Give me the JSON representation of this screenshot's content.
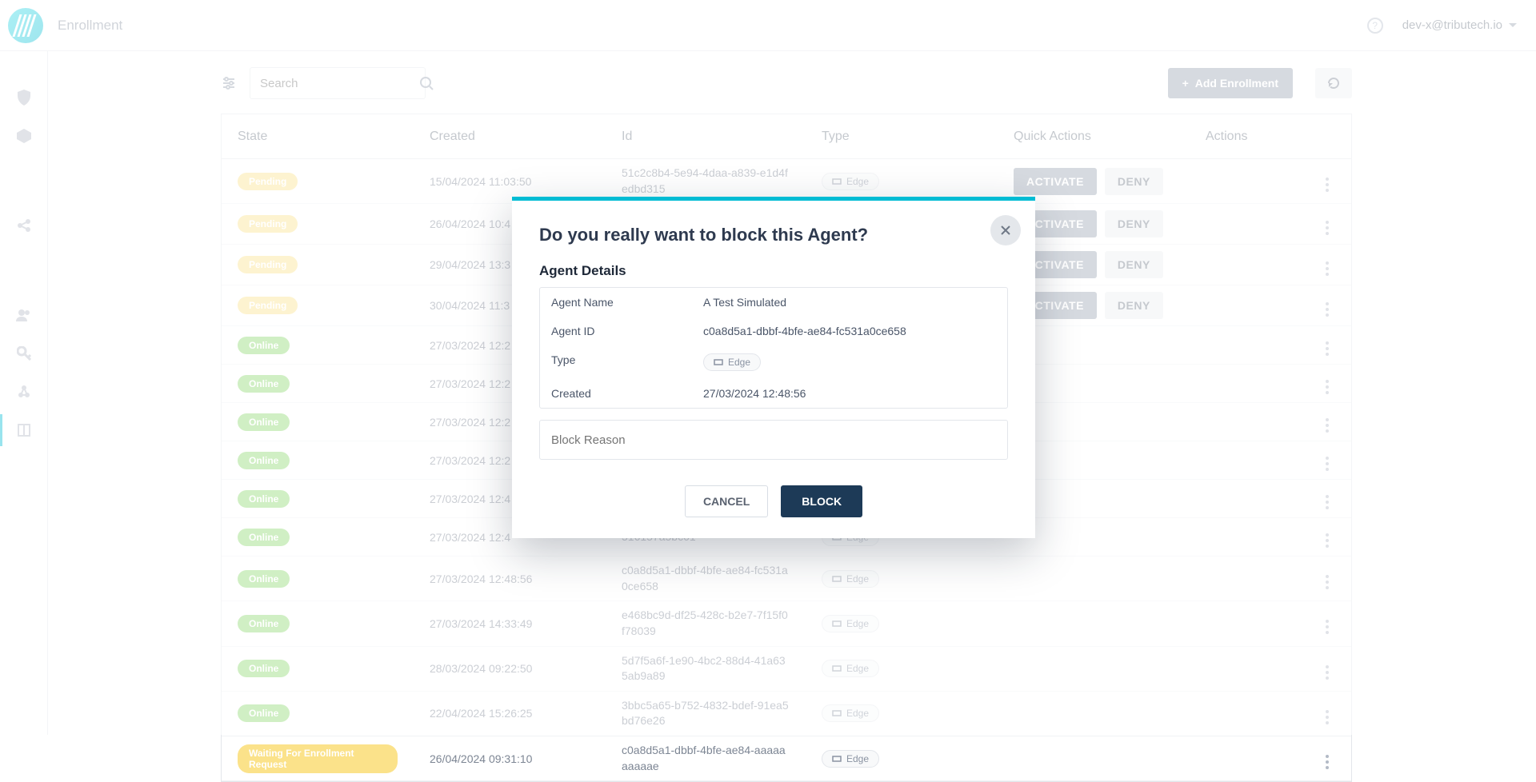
{
  "header": {
    "title": "Enrollment",
    "user_label": "dev-x@tributech.io"
  },
  "toolbar": {
    "search_placeholder": "Search",
    "add_label": "Add Enrollment"
  },
  "table": {
    "columns": {
      "state": "State",
      "created": "Created",
      "id": "Id",
      "type": "Type",
      "quick_actions": "Quick Actions",
      "actions": "Actions"
    },
    "type_chip_label": "Edge",
    "activate_label": "ACTIVATE",
    "deny_label": "DENY",
    "rows": [
      {
        "state": "Pending",
        "state_kind": "pending",
        "created": "15/04/2024 11:03:50",
        "id": "51c2c8b4-5e94-4daa-a839-e1d4fedbd315",
        "has_qa": true
      },
      {
        "state": "Pending",
        "state_kind": "pending",
        "created": "26/04/2024 10:4",
        "id": "",
        "has_qa": true
      },
      {
        "state": "Pending",
        "state_kind": "pending",
        "created": "29/04/2024 13:3",
        "id": "",
        "has_qa": true
      },
      {
        "state": "Pending",
        "state_kind": "pending",
        "created": "30/04/2024 11:3",
        "id": "",
        "has_qa": true
      },
      {
        "state": "Online",
        "state_kind": "online",
        "created": "27/03/2024 12:2",
        "id": "",
        "has_qa": false
      },
      {
        "state": "Online",
        "state_kind": "online",
        "created": "27/03/2024 12:2",
        "id": "",
        "has_qa": false
      },
      {
        "state": "Online",
        "state_kind": "online",
        "created": "27/03/2024 12:2",
        "id": "",
        "has_qa": false
      },
      {
        "state": "Online",
        "state_kind": "online",
        "created": "27/03/2024 12:2",
        "id": "",
        "has_qa": false
      },
      {
        "state": "Online",
        "state_kind": "online",
        "created": "27/03/2024 12:4",
        "id": "",
        "has_qa": false
      },
      {
        "state": "Online",
        "state_kind": "online",
        "created": "27/03/2024 12:4",
        "id": "516157a5bc01",
        "has_qa": false
      },
      {
        "state": "Online",
        "state_kind": "online",
        "created": "27/03/2024 12:48:56",
        "id": "c0a8d5a1-dbbf-4bfe-ae84-fc531a0ce658",
        "has_qa": false
      },
      {
        "state": "Online",
        "state_kind": "online",
        "created": "27/03/2024 14:33:49",
        "id": "e468bc9d-df25-428c-b2e7-7f15f0f78039",
        "has_qa": false
      },
      {
        "state": "Online",
        "state_kind": "online",
        "created": "28/03/2024 09:22:50",
        "id": "5d7f5a6f-1e90-4bc2-88d4-41a635ab9a89",
        "has_qa": false
      },
      {
        "state": "Online",
        "state_kind": "online",
        "created": "22/04/2024 15:26:25",
        "id": "3bbc5a65-b752-4832-bdef-91ea5bd76e26",
        "has_qa": false
      },
      {
        "state": "Waiting For Enrollment Request",
        "state_kind": "waiting",
        "created": "26/04/2024 09:31:10",
        "id": "c0a8d5a1-dbbf-4bfe-ae84-aaaaaaaaaae",
        "has_qa": false
      }
    ]
  },
  "modal": {
    "title": "Do you really want to block this Agent?",
    "subtitle": "Agent Details",
    "fields": {
      "name_k": "Agent Name",
      "name_v": "A Test Simulated",
      "id_k": "Agent ID",
      "id_v": "c0a8d5a1-dbbf-4bfe-ae84-fc531a0ce658",
      "type_k": "Type",
      "type_v": "Edge",
      "created_k": "Created",
      "created_v": "27/03/2024 12:48:56"
    },
    "reason_placeholder": "Block Reason",
    "cancel_label": "CANCEL",
    "block_label": "BLOCK"
  }
}
